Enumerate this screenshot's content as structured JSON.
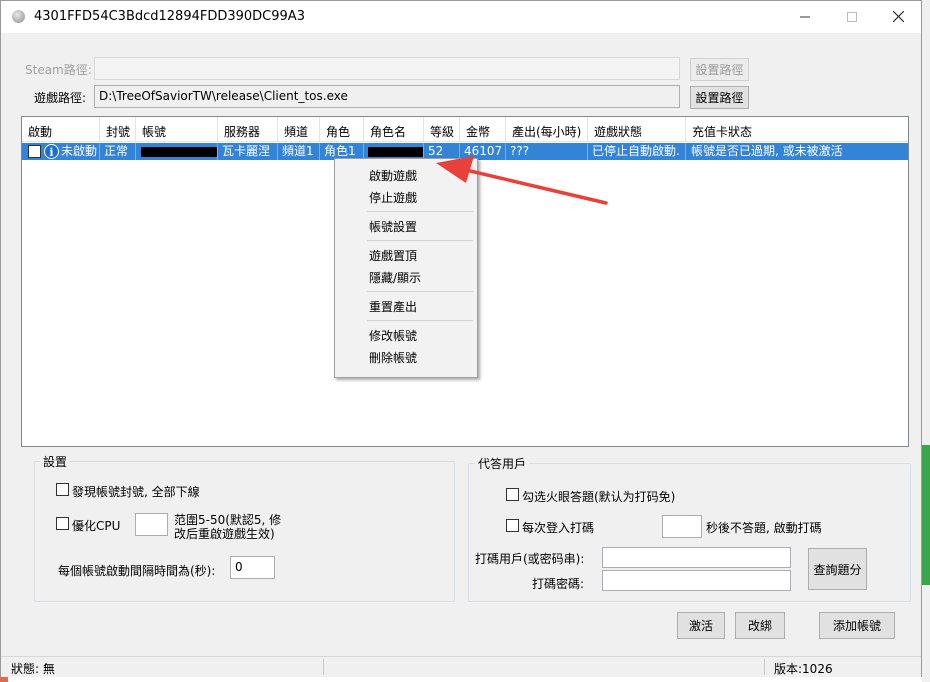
{
  "window": {
    "title": "4301FFD54C3Bdcd12894FDD390DC99A3"
  },
  "paths": {
    "steam_label": "Steam路徑:",
    "steam_value": "",
    "steam_button": "設置路徑",
    "game_label": "遊戲路徑:",
    "game_value": "D:\\TreeOfSaviorTW\\release\\Client_tos.exe",
    "game_button": "設置路徑"
  },
  "table": {
    "columns": [
      "啟動",
      "封號",
      "帳號",
      "服務器",
      "頻道",
      "角色",
      "角色名",
      "等級",
      "金幣",
      "產出(每小時)",
      "遊戲狀態",
      "充值卡狀态"
    ],
    "rows": [
      {
        "start": "未啟動",
        "ban": "正常",
        "account": "",
        "server": "瓦卡麗涅",
        "channel": "頻道1",
        "role": "角色1",
        "role_name": "",
        "level": "52",
        "gold": "46107",
        "output": "???",
        "game_status": "已停止自動啟動.",
        "card_status": "帳號是否已過期, 或未被激活"
      }
    ]
  },
  "context_menu": {
    "items": [
      "啟動遊戲",
      "停止遊戲",
      "帳號設置",
      "遊戲置頂",
      "隱藏/顯示",
      "重置產出",
      "修改帳號",
      "刪除帳號"
    ]
  },
  "settings": {
    "title": "設置",
    "offline_on_ban": "發現帳號封號, 全部下線",
    "optimize_cpu": "優化CPU",
    "cpu_value": "",
    "cpu_range_note": "范圍5-50(默認5, 修改后重啟遊戲生效)",
    "interval_label": "每個帳號啟動間隔時間為(秒):",
    "interval_value": "0"
  },
  "proxy": {
    "title": "代答用戶",
    "captcha_check": "勾选火眼答題(默认为打码免)",
    "every_login": "每次登入打碼",
    "timeout_value": "",
    "timeout_note": "秒後不答題, 啟動打碼",
    "user_label": "打碼用戶(或密码串):",
    "user_value": "",
    "pass_label": "打碼密碼:",
    "pass_value": "",
    "query_button": "查詢題分"
  },
  "buttons": {
    "activate": "激活",
    "rebind": "改綁",
    "add_account": "添加帳號"
  },
  "statusbar": {
    "status": "狀態: 無",
    "version": "版本:1026"
  },
  "colors": {
    "selection": "#3383d6",
    "arrow": "#e8403a"
  }
}
